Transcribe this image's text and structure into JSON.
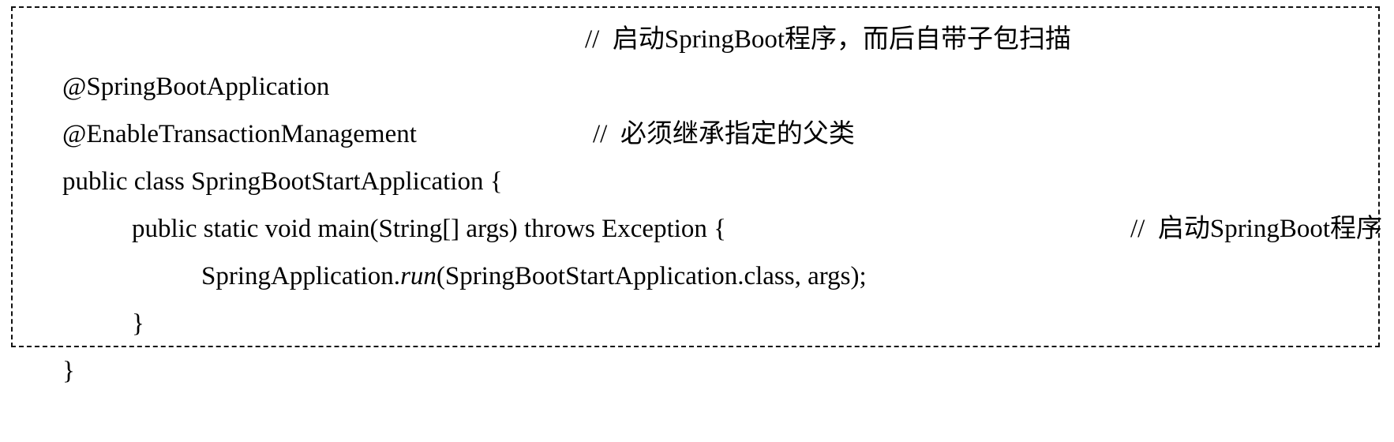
{
  "code": {
    "line1": {
      "text": "@SpringBootApplication",
      "comment": "//  启动SpringBoot程序，而后自带子包扫描"
    },
    "line2": {
      "text": "@EnableTransactionManagement"
    },
    "line3": {
      "text": "public class SpringBootStartApplication {",
      "comment": "//  必须继承指定的父类"
    },
    "line4": {
      "text": "public static void main(String[] args) throws Exception {"
    },
    "line5": {
      "prefix": "SpringApplication.",
      "method": "run",
      "suffix": "(SpringBootStartApplication.class, args);",
      "comment": "//  启动SpringBoot程序"
    },
    "line6": {
      "text": "}"
    },
    "line7": {
      "text": "}"
    }
  }
}
